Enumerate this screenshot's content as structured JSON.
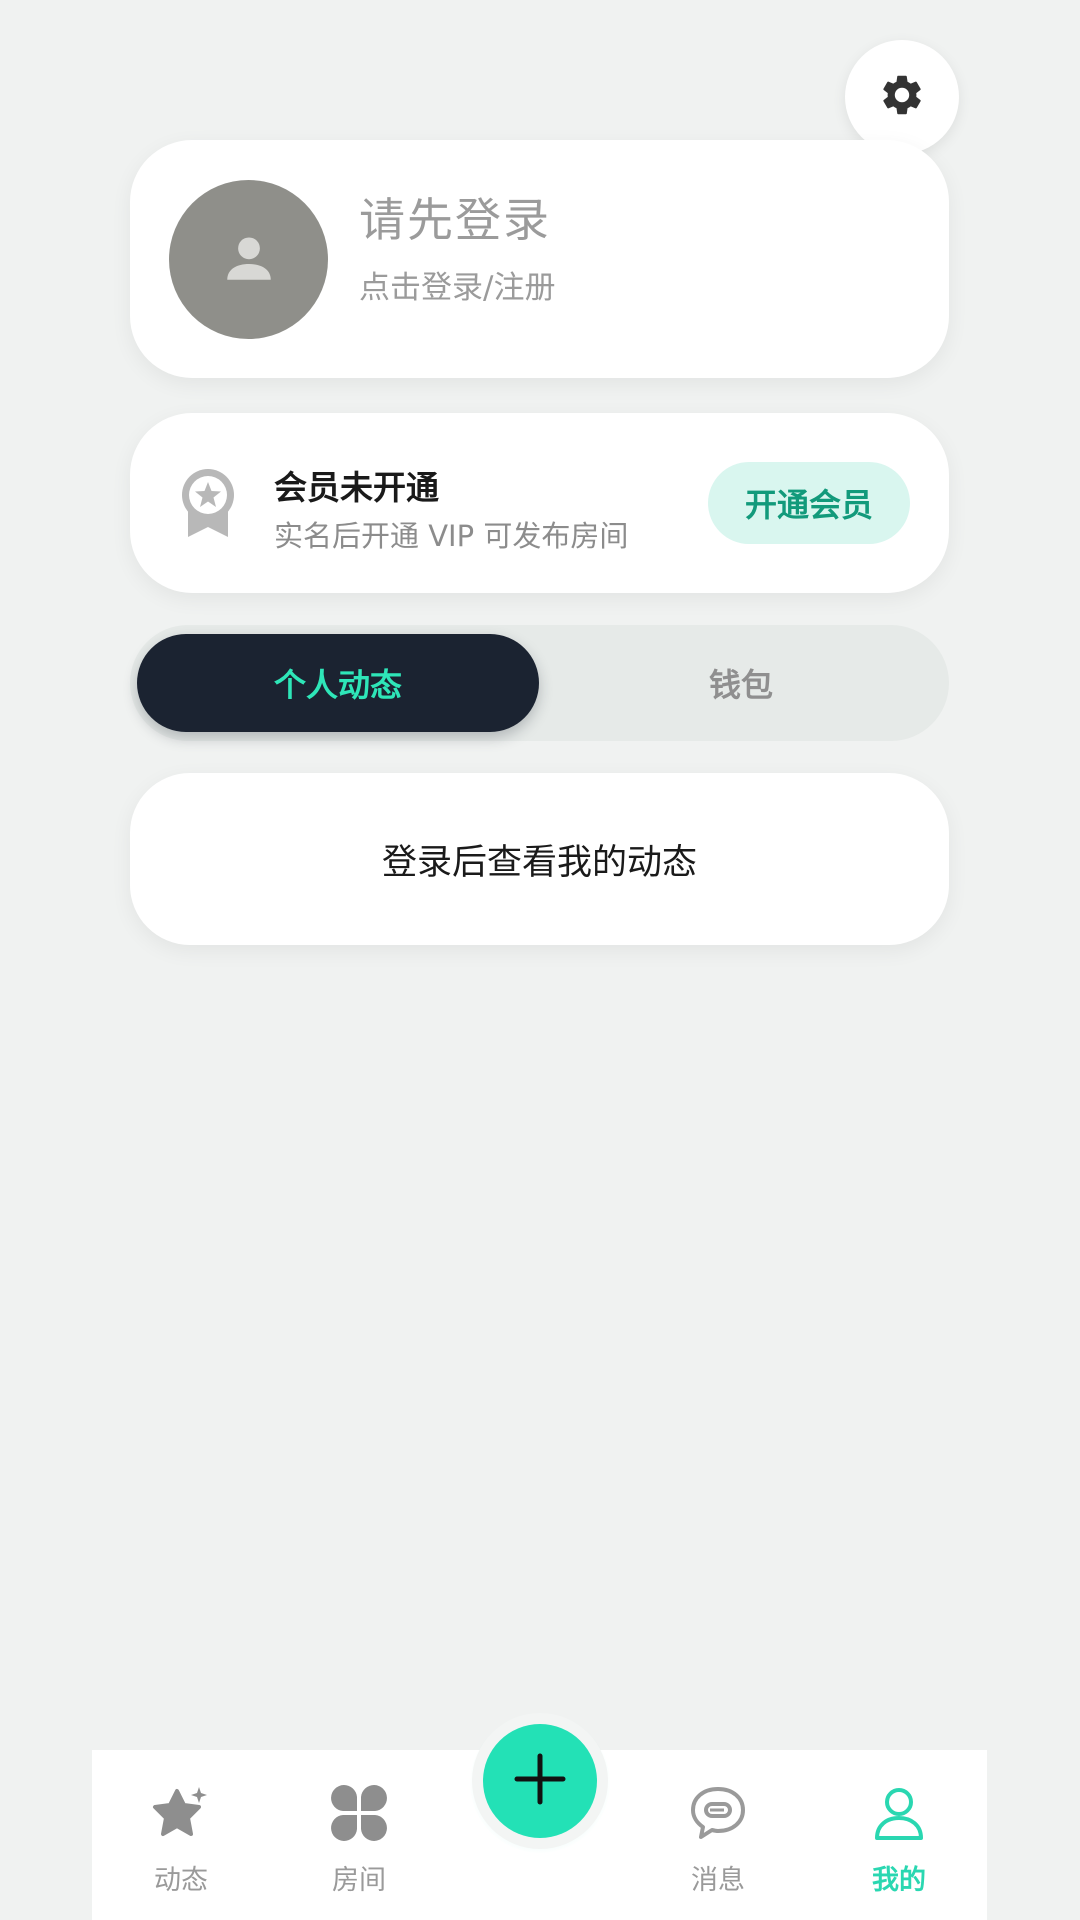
{
  "profile": {
    "title": "请先登录",
    "subtitle": "点击登录/注册"
  },
  "vip": {
    "title": "会员未开通",
    "subtitle": "实名后开通 VIP 可发布房间",
    "button": "开通会员"
  },
  "tabs": [
    {
      "label": "个人动态",
      "active": true
    },
    {
      "label": "钱包",
      "active": false
    }
  ],
  "activity": {
    "empty_text": "登录后查看我的动态"
  },
  "bottom_nav": {
    "items": [
      {
        "label": "动态",
        "icon": "star-icon"
      },
      {
        "label": "房间",
        "icon": "clover-icon"
      },
      {
        "label": "消息",
        "icon": "chat-bubble-icon"
      },
      {
        "label": "我的",
        "icon": "person-icon",
        "active": true
      }
    ],
    "fab_icon": "plus-icon"
  },
  "colors": {
    "accent": "#23e1b6",
    "tab_active_bg": "#1b2331",
    "background": "#f0f2f1"
  }
}
